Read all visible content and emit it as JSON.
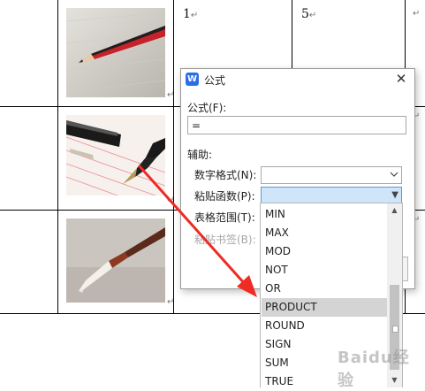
{
  "document": {
    "cell_values": [
      "1",
      "5"
    ],
    "paragraph_mark": "↵"
  },
  "dialog": {
    "title": "公式",
    "close_glyph": "✕",
    "formula_label": "公式(F):",
    "formula_value": "=",
    "helper_label": "辅助:",
    "number_format_label": "数字格式(N):",
    "paste_function_label": "粘贴函数(P):",
    "table_range_label": "表格范围(T):",
    "paste_bookmark_label": "粘贴书签(B):",
    "dropdown_arrow": "▼"
  },
  "dropdown": {
    "options": [
      "MIN",
      "MAX",
      "MOD",
      "NOT",
      "OR",
      "PRODUCT",
      "ROUND",
      "SIGN",
      "SUM",
      "TRUE"
    ],
    "selected": "PRODUCT",
    "scroll_up": "▲",
    "scroll_down": "▼"
  },
  "annotation": {
    "arrow_color": "#ee2b25"
  },
  "watermark": "Baidu经验"
}
